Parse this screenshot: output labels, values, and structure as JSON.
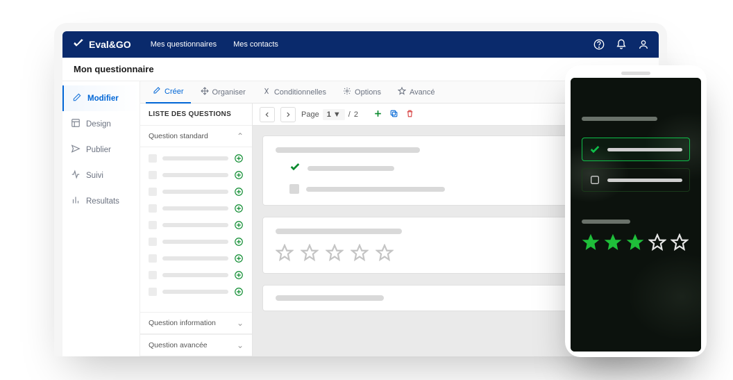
{
  "brand": {
    "name": "Eval&GO"
  },
  "nav": {
    "links": [
      "Mes questionnaires",
      "Mes contacts"
    ]
  },
  "breadcrumb": "Mon questionnaire",
  "sidebar": {
    "items": [
      {
        "label": "Modifier",
        "icon": "edit-icon"
      },
      {
        "label": "Design",
        "icon": "layout-icon"
      },
      {
        "label": "Publier",
        "icon": "send-icon"
      },
      {
        "label": "Suivi",
        "icon": "activity-icon"
      },
      {
        "label": "Resultats",
        "icon": "bars-icon"
      }
    ],
    "active_index": 0
  },
  "tabs": {
    "items": [
      {
        "label": "Créer",
        "icon": "pencil-icon"
      },
      {
        "label": "Organiser",
        "icon": "move-icon"
      },
      {
        "label": "Conditionnelles",
        "icon": "branch-icon"
      },
      {
        "label": "Options",
        "icon": "gear-icon"
      },
      {
        "label": "Avancé",
        "icon": "star-icon"
      }
    ],
    "active_index": 0
  },
  "question_panel": {
    "title": "LISTE DES QUESTIONS",
    "sections": [
      {
        "label": "Question standard",
        "expanded": true
      },
      {
        "label": "Question information",
        "expanded": false
      },
      {
        "label": "Question avancée",
        "expanded": false
      }
    ],
    "placeholder_rows": 9
  },
  "toolbar": {
    "page_label": "Page",
    "page_current": "1 ▼",
    "page_sep": "/",
    "page_total": "2"
  },
  "phone_preview": {
    "stars_filled": 3,
    "stars_total": 5
  },
  "colors": {
    "primary_nav": "#0a2a6c",
    "accent_blue": "#0066d6",
    "accent_green": "#0a8a2d",
    "star_green": "#1fbf3a",
    "danger": "#d63838"
  },
  "chart_data": {
    "type": "table",
    "note": "no chart present"
  }
}
